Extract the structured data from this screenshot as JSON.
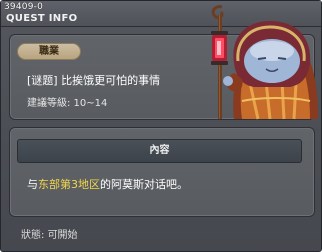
{
  "window": {
    "quest_id": "39409-0",
    "title": "QUEST INFO"
  },
  "quest": {
    "job_label": "職業",
    "name": "[谜题] 比挨饿更可怕的事情",
    "level_requirement": "建議等級: 10~14"
  },
  "content": {
    "header": "內容",
    "text_before": "与",
    "highlight": "东部第3地区",
    "text_after": "的阿莫斯对话吧。"
  },
  "status": {
    "label": "狀態:",
    "value": "可開始"
  },
  "colors": {
    "highlight": "#f2d64b",
    "badge": "#c4b290",
    "background": "#4f5258"
  },
  "icons": {
    "npc": "hooded-npc-with-lantern-staff"
  }
}
